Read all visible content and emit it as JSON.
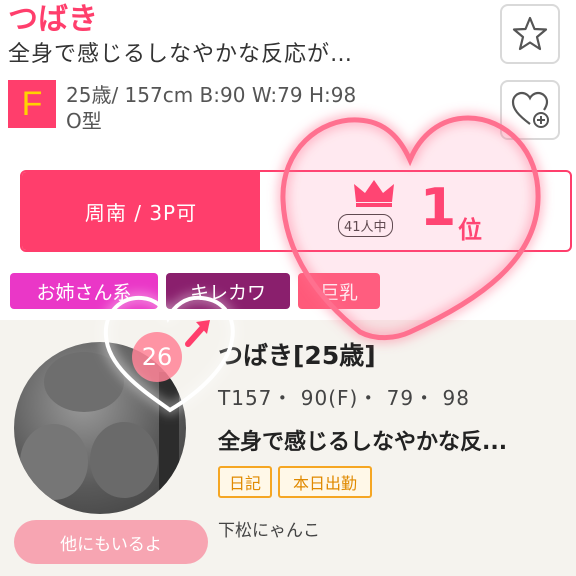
{
  "profile": {
    "name": "つばき",
    "catch": "全身で感じるしなやかな反応が…",
    "cup": "F",
    "specs_line1": "25歳/ 157cm B:90 W:79 H:98",
    "specs_line2": "O型"
  },
  "actions": {
    "favorite_icon": "star-icon",
    "follow_icon": "heart-plus-icon"
  },
  "ranking": {
    "area": "周南 / 3P可",
    "of_label": "41人中",
    "rank": "1",
    "rank_suffix": "位",
    "icon": "crown-icon"
  },
  "tags": [
    "お姉さん系",
    "キレカワ",
    "巨乳"
  ],
  "card": {
    "badge_number": "26",
    "name": "つばき[25歳]",
    "specs": "T157・ 90(F)・ 79・ 98",
    "catch": "全身で感じるしなやかな反...",
    "tags": [
      "日記",
      "本日出勤"
    ],
    "shop": "下松にゃんこ",
    "others_button": "他にもいるよ"
  },
  "colors": {
    "accent": "#ff3e6c",
    "tag1": "#ea37c7",
    "tag2": "#8a1f6d",
    "tag3": "#ff5a7a",
    "card_tag": "#f5a623"
  }
}
